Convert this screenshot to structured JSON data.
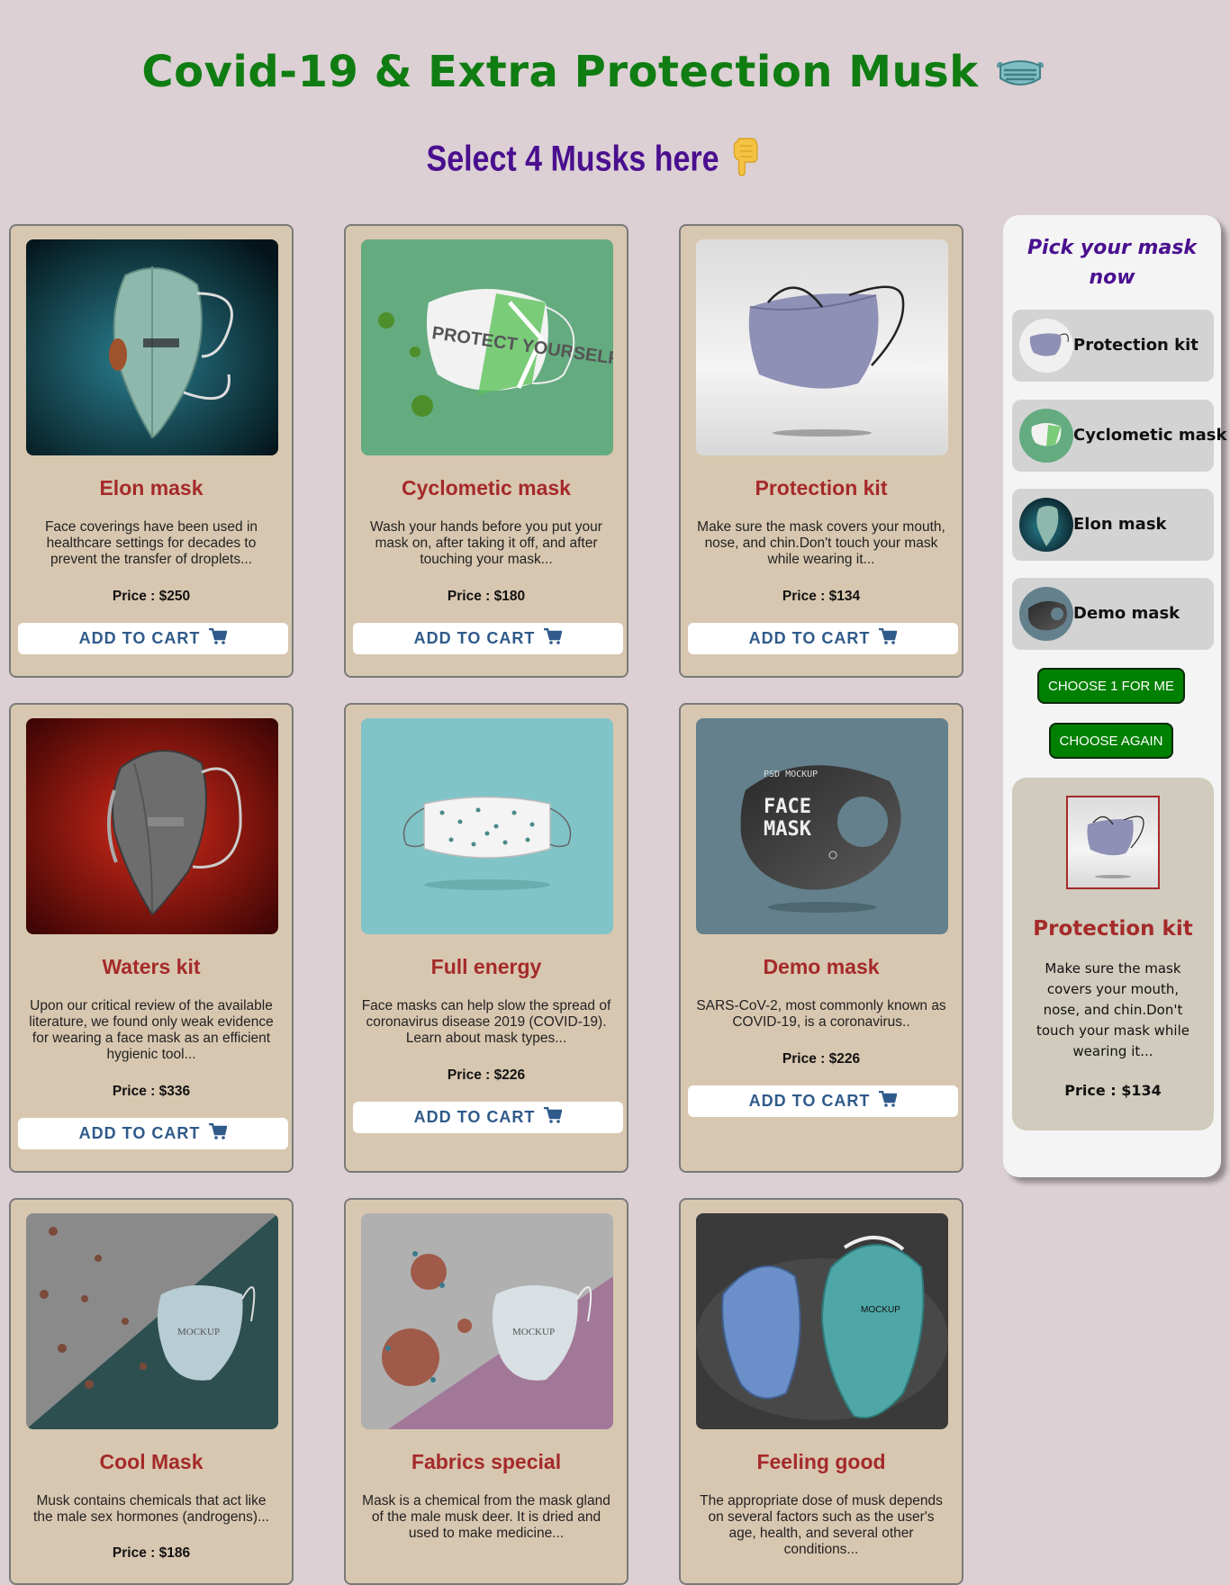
{
  "header": {
    "title": "Covid-19 & Extra Protection Musk",
    "title_icon": "face-mask-icon",
    "subtitle": "Select 4 Musks here",
    "subtitle_icon": "pointing-down-hand-icon"
  },
  "colors": {
    "page_bg": "#dcd0d4",
    "title": "#0f7d12",
    "subtitle": "#4a0f8f",
    "card_bg": "#d8c7b0",
    "card_title": "#a52a2a",
    "cart_text": "#2f5a8a",
    "action_button": "#008000"
  },
  "cart_label": "ADD TO CART",
  "cart_icon": "shopping-cart-icon",
  "products": [
    {
      "title": "Elon mask",
      "desc": "Face coverings have been used in healthcare settings for decades to prevent the transfer of droplets...",
      "price": "Price : $250"
    },
    {
      "title": "Cyclometic mask",
      "desc": "Wash your hands before you put your mask on, after taking it off, and after touching your mask...",
      "price": "Price : $180"
    },
    {
      "title": "Protection kit",
      "desc": "Make sure the mask covers your mouth, nose, and chin.Don't touch your mask while wearing it...",
      "price": "Price : $134"
    },
    {
      "title": "Waters kit",
      "desc": "Upon our critical review of the available literature, we found only weak evidence for wearing a face mask as an efficient hygienic tool...",
      "price": "Price : $336"
    },
    {
      "title": "Full energy",
      "desc": "Face masks can help slow the spread of coronavirus disease 2019 (COVID-19). Learn about mask types...",
      "price": "Price : $226"
    },
    {
      "title": "Demo mask",
      "desc": "SARS-CoV-2, most commonly known as COVID-19, is a coronavirus..",
      "price": "Price : $226"
    },
    {
      "title": "Cool Mask",
      "desc": "Musk contains chemicals that act like the male sex hormones (androgens)...",
      "price": "Price : $186"
    },
    {
      "title": "Fabrics special",
      "desc": "Mask is a chemical from the mask gland of the male musk deer. It is dried and used to make medicine...",
      "price": ""
    },
    {
      "title": "Feeling good",
      "desc": "The appropriate dose of musk depends on several factors such as the user's age, health, and several other conditions...",
      "price": ""
    }
  ],
  "sidebar": {
    "title_line1": "Pick your mask",
    "title_line2": "now",
    "picked": [
      "Protection kit",
      "Cyclometic mask",
      "Elon mask",
      "Demo mask"
    ],
    "choose_button": "CHOOSE 1 FOR ME",
    "again_button": "CHOOSE AGAIN",
    "result": {
      "title": "Protection kit",
      "desc": "Make sure the mask covers your mouth, nose, and chin.Don't touch your mask while wearing it...",
      "price_label": "Price : ",
      "price_value": "$134"
    }
  }
}
